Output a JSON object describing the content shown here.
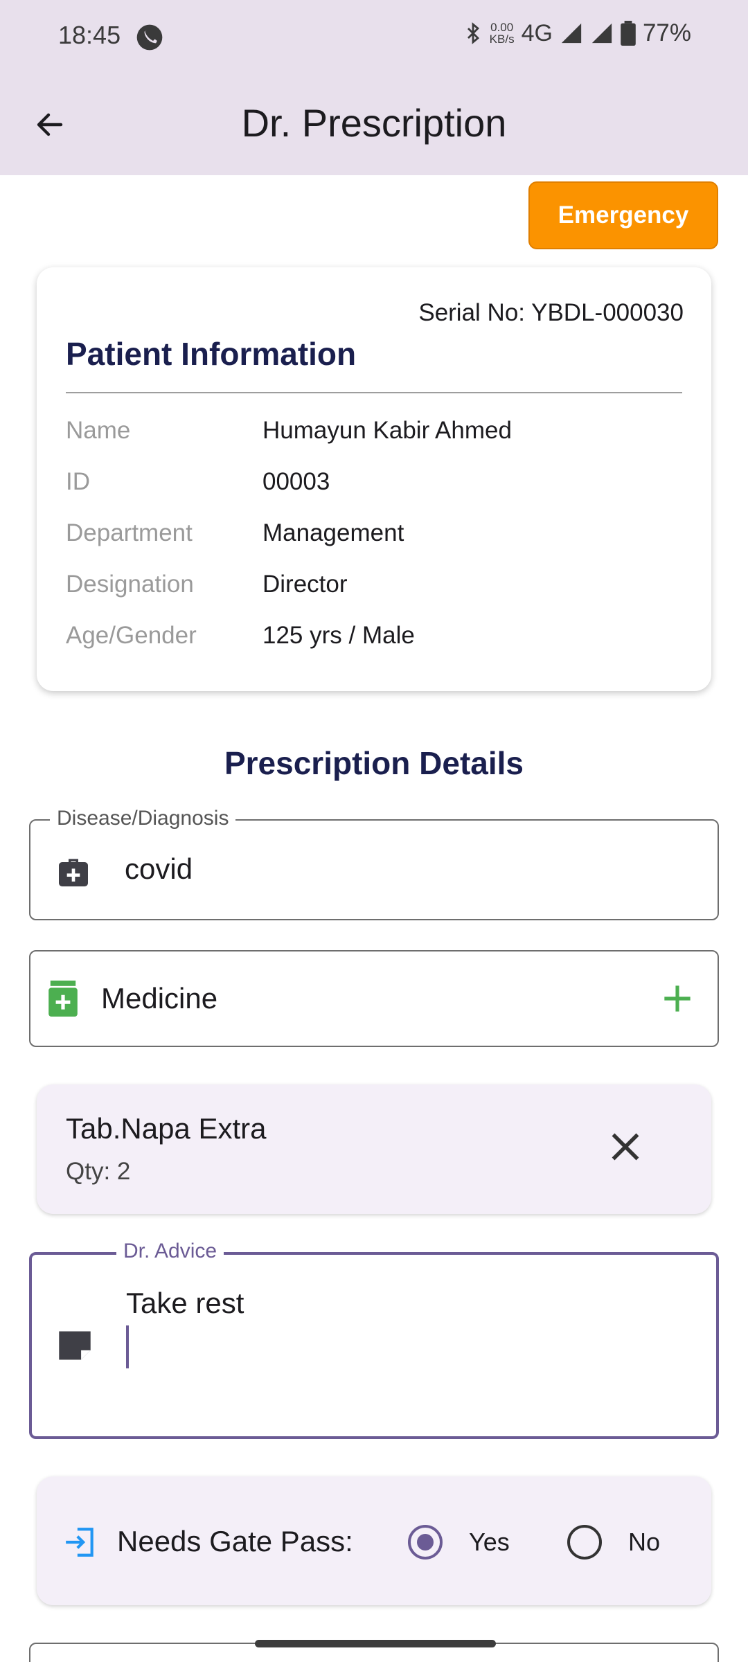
{
  "status_bar": {
    "time": "18:45",
    "speed_value": "0.00",
    "speed_unit": "KB/s",
    "network": "4G",
    "battery": "77%"
  },
  "app_bar": {
    "title": "Dr. Prescription",
    "back_icon": "arrow-left-icon"
  },
  "emergency_button": {
    "label": "Emergency",
    "color": "#fb9300"
  },
  "patient": {
    "serial": "Serial No: YBDL-000030",
    "title": "Patient Information",
    "rows": [
      {
        "label": "Name",
        "value": "Humayun Kabir Ahmed"
      },
      {
        "label": "ID",
        "value": "00003"
      },
      {
        "label": "Department",
        "value": "Management"
      },
      {
        "label": "Designation",
        "value": "Director"
      },
      {
        "label": "Age/Gender",
        "value": "125 yrs / Male"
      }
    ]
  },
  "prescription": {
    "title": "Prescription Details",
    "diagnosis": {
      "label": "Disease/Diagnosis",
      "value": "covid",
      "icon": "medical-bag-icon"
    },
    "medicine": {
      "label": "Medicine",
      "icon": "medicine-bottle-icon",
      "add_icon": "plus-icon"
    },
    "medicines": [
      {
        "name": "Tab.Napa Extra",
        "qty": "Qty: 2"
      }
    ],
    "advice": {
      "label": "Dr. Advice",
      "value": "Take rest",
      "icon": "note-icon"
    },
    "gate_pass": {
      "label": "Needs Gate Pass:",
      "icon": "login-icon",
      "options": [
        "Yes",
        "No"
      ],
      "selected": "Yes"
    }
  },
  "colors": {
    "primary": "#6b5b95",
    "heading": "#1a1f4e",
    "accent_green": "#4caf50",
    "app_bar": "#e8e0ec"
  }
}
